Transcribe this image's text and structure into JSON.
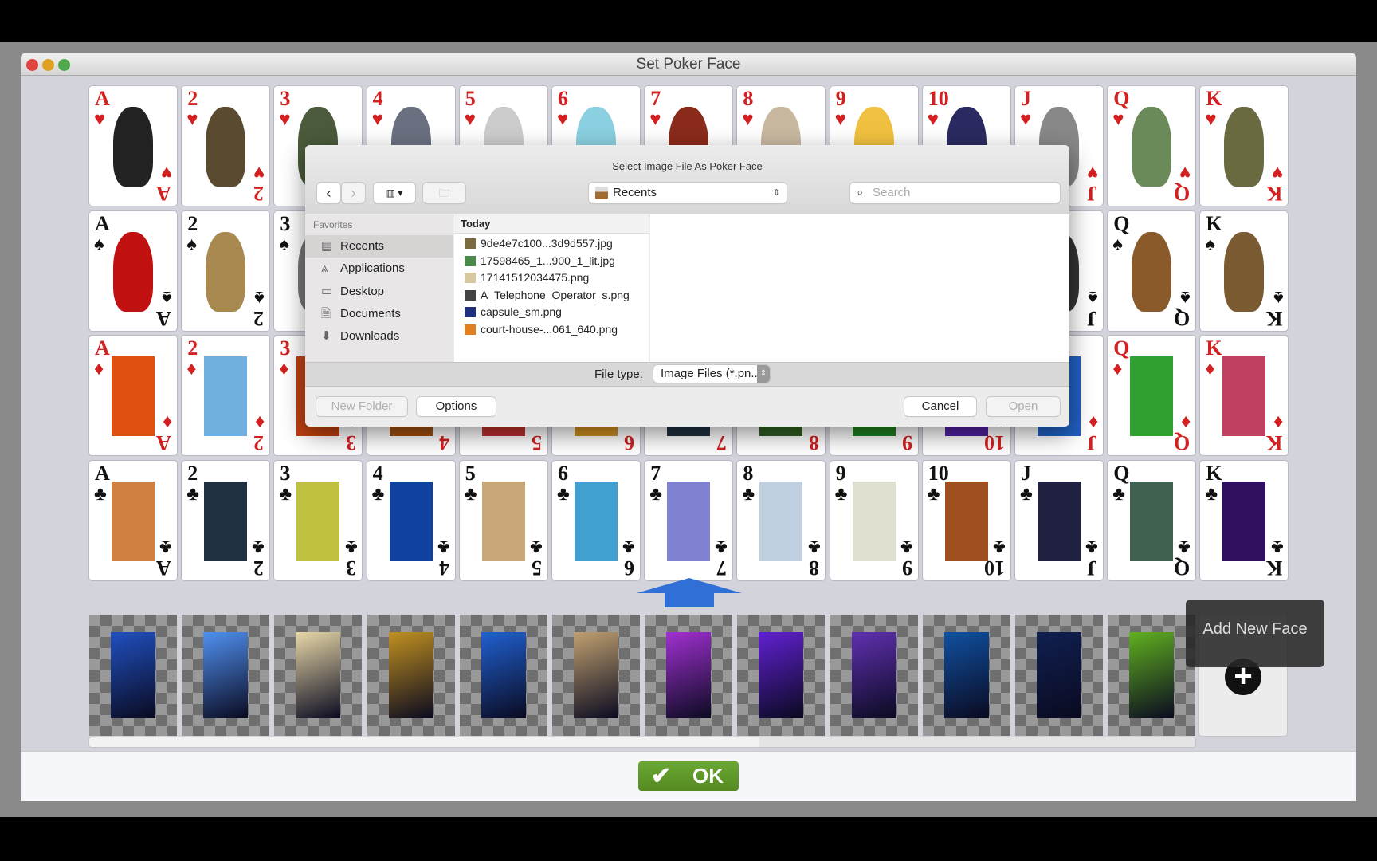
{
  "window": {
    "title": "Set Poker Face",
    "lights": [
      "#e0443e",
      "#dea123",
      "#4fa94a"
    ]
  },
  "ranks": [
    "A",
    "2",
    "3",
    "4",
    "5",
    "6",
    "7",
    "8",
    "9",
    "10",
    "J",
    "Q",
    "K"
  ],
  "suits": [
    {
      "name": "hearts",
      "glyph": "♥",
      "color": "#d42020"
    },
    {
      "name": "spades",
      "glyph": "♠",
      "color": "#111111"
    },
    {
      "name": "diamonds",
      "glyph": "♦",
      "color": "#d42020"
    },
    {
      "name": "clubs",
      "glyph": "♣",
      "color": "#111111"
    }
  ],
  "card_art_colors": [
    [
      "#222222",
      "#5a4a30",
      "#4a5a3a",
      "#6a7080",
      "#cccccc",
      "#8ad0e0",
      "#8a2a1a",
      "#c8b8a0",
      "#f0c040",
      "#2a2a60",
      "#888888",
      "#6a8a5a",
      "#6a6a40"
    ],
    [
      "#c01010",
      "#a88a50",
      "#777777",
      "#777777",
      "#777777",
      "#777777",
      "#777777",
      "#777777",
      "#777777",
      "#777777",
      "#333333",
      "#8a5a2a",
      "#7a5a30"
    ],
    [
      "#e05010",
      "#70b0e0",
      "#c04010",
      "#a05010",
      "#c03030",
      "#d09020",
      "#203040",
      "#306020",
      "#208020",
      "#5020a0",
      "#2060c0",
      "#30a030",
      "#c04060"
    ],
    [
      "#d08040",
      "#203040",
      "#c0c040",
      "#1040a0",
      "#c8a878",
      "#40a0d0",
      "#8080d0",
      "#c0d0e0",
      "#e0e0d0",
      "#a05020",
      "#202040",
      "#406050",
      "#301060"
    ]
  ],
  "arrow": {
    "color": "#2f6fd6"
  },
  "face_strip": {
    "tiles": [
      "#2050c0",
      "#5090f0",
      "#e8d8a8",
      "#c09020",
      "#2060d0",
      "#c0a070",
      "#a030d0",
      "#6020d0",
      "#6030b0",
      "#1050a0",
      "#102050",
      "#60b020"
    ],
    "add_tooltip": "Add New Face",
    "add_icon": "plus-circle-icon"
  },
  "ok_button": {
    "label": "OK",
    "color": "#5f9a2a"
  },
  "dialog": {
    "title": "Select Image File As Poker Face",
    "location": "Recents",
    "search_placeholder": "Search",
    "sidebar_heading": "Favorites",
    "sidebar": [
      {
        "label": "Recents",
        "icon": "recents-icon",
        "selected": true
      },
      {
        "label": "Applications",
        "icon": "applications-icon"
      },
      {
        "label": "Desktop",
        "icon": "desktop-icon"
      },
      {
        "label": "Documents",
        "icon": "documents-icon"
      },
      {
        "label": "Downloads",
        "icon": "downloads-icon"
      }
    ],
    "group": "Today",
    "files": [
      {
        "name": "9de4e7c100...3d9d557.jpg",
        "thumb": "#7a6a40"
      },
      {
        "name": "17598465_1...900_1_lit.jpg",
        "thumb": "#4a8a4a"
      },
      {
        "name": "17141512034475.png",
        "thumb": "#d8c8a0"
      },
      {
        "name": "A_Telephone_Operator_s.png",
        "thumb": "#444444"
      },
      {
        "name": "capsule_sm.png",
        "thumb": "#203080"
      },
      {
        "name": "court-house-...061_640.png",
        "thumb": "#e08020"
      }
    ],
    "file_type_label": "File type:",
    "file_type_value": "Image Files (*.pn...",
    "new_folder": "New Folder",
    "options": "Options",
    "cancel": "Cancel",
    "open": "Open"
  }
}
